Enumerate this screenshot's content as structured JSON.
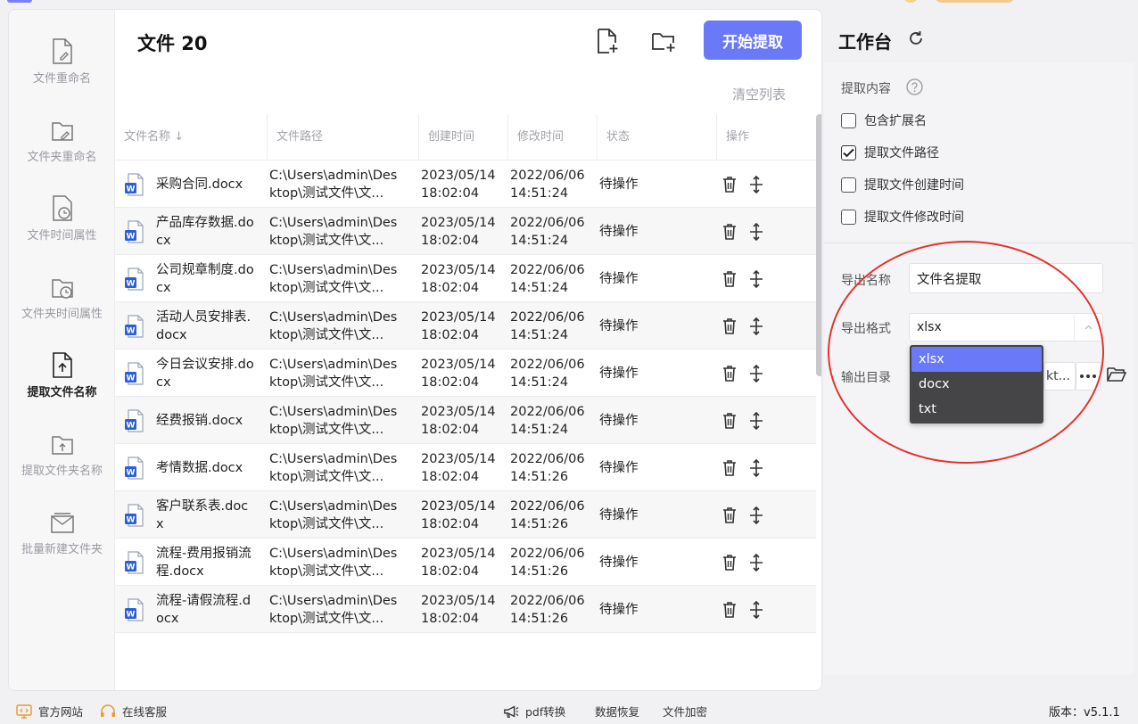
{
  "sidebar": {
    "items": [
      {
        "label": "文件重命名",
        "icon": "file-edit-icon"
      },
      {
        "label": "文件夹重命名",
        "icon": "folder-edit-icon"
      },
      {
        "label": "文件时间属性",
        "icon": "file-clock-icon"
      },
      {
        "label": "文件夹时间属性",
        "icon": "folder-clock-icon"
      },
      {
        "label": "提取文件名称",
        "icon": "file-extract-icon",
        "active": true
      },
      {
        "label": "提取文件夹名称",
        "icon": "folder-extract-icon"
      },
      {
        "label": "批量新建文件夹",
        "icon": "folder-batch-icon"
      }
    ]
  },
  "header": {
    "title": "文件 20",
    "start_label": "开始提取",
    "clear_label": "清空列表",
    "add_file_icon": "add-file-icon",
    "add_folder_icon": "add-folder-icon"
  },
  "table": {
    "columns": [
      "文件名称",
      "文件路径",
      "创建时间",
      "修改时间",
      "状态",
      "操作"
    ],
    "rows": [
      {
        "name": "采购合同.docx",
        "path": "C:\\Users\\admin\\Desktop\\测试文件\\文...",
        "ctime1": "2023/05/14",
        "ctime2": "18:02:04",
        "mtime1": "2022/06/06",
        "mtime2": "14:51:24",
        "status": "待操作"
      },
      {
        "name": "产品库存数据.docx",
        "path": "C:\\Users\\admin\\Desktop\\测试文件\\文...",
        "ctime1": "2023/05/14",
        "ctime2": "18:02:04",
        "mtime1": "2022/06/06",
        "mtime2": "14:51:24",
        "status": "待操作"
      },
      {
        "name": "公司规章制度.docx",
        "path": "C:\\Users\\admin\\Desktop\\测试文件\\文...",
        "ctime1": "2023/05/14",
        "ctime2": "18:02:04",
        "mtime1": "2022/06/06",
        "mtime2": "14:51:24",
        "status": "待操作"
      },
      {
        "name": "活动人员安排表.docx",
        "path": "C:\\Users\\admin\\Desktop\\测试文件\\文...",
        "ctime1": "2023/05/14",
        "ctime2": "18:02:04",
        "mtime1": "2022/06/06",
        "mtime2": "14:51:24",
        "status": "待操作"
      },
      {
        "name": "今日会议安排.docx",
        "path": "C:\\Users\\admin\\Desktop\\测试文件\\文...",
        "ctime1": "2023/05/14",
        "ctime2": "18:02:04",
        "mtime1": "2022/06/06",
        "mtime2": "14:51:24",
        "status": "待操作"
      },
      {
        "name": "经费报销.docx",
        "path": "C:\\Users\\admin\\Desktop\\测试文件\\文...",
        "ctime1": "2023/05/14",
        "ctime2": "18:02:04",
        "mtime1": "2022/06/06",
        "mtime2": "14:51:24",
        "status": "待操作"
      },
      {
        "name": "考情数据.docx",
        "path": "C:\\Users\\admin\\Desktop\\测试文件\\文...",
        "ctime1": "2023/05/14",
        "ctime2": "18:02:04",
        "mtime1": "2022/06/06",
        "mtime2": "14:51:26",
        "status": "待操作"
      },
      {
        "name": "客户联系表.docx",
        "path": "C:\\Users\\admin\\Desktop\\测试文件\\文...",
        "ctime1": "2023/05/14",
        "ctime2": "18:02:04",
        "mtime1": "2022/06/06",
        "mtime2": "14:51:26",
        "status": "待操作"
      },
      {
        "name": "流程-费用报销流程.docx",
        "path": "C:\\Users\\admin\\Desktop\\测试文件\\文...",
        "ctime1": "2023/05/14",
        "ctime2": "18:02:04",
        "mtime1": "2022/06/06",
        "mtime2": "14:51:26",
        "status": "待操作"
      },
      {
        "name": "流程-请假流程.docx",
        "path": "C:\\Users\\admin\\Desktop\\测试文件\\文...",
        "ctime1": "2023/05/14",
        "ctime2": "18:02:04",
        "mtime1": "2022/06/06",
        "mtime2": "14:51:26",
        "status": "待操作"
      }
    ]
  },
  "workbench": {
    "title": "工作台",
    "extract_label": "提取内容",
    "options": [
      {
        "label": "包含扩展名",
        "checked": false
      },
      {
        "label": "提取文件路径",
        "checked": true
      },
      {
        "label": "提取文件创建时间",
        "checked": false
      },
      {
        "label": "提取文件修改时间",
        "checked": false
      }
    ],
    "export_name_label": "导出名称",
    "export_name_value": "文件名提取",
    "export_format_label": "导出格式",
    "export_format_value": "xlsx",
    "output_dir_label": "输出目录",
    "output_dir_value": "kt...",
    "format_options": [
      "xlsx",
      "docx",
      "txt"
    ]
  },
  "footer": {
    "website": "官方网站",
    "support": "在线客服",
    "pdf": "pdf转换",
    "recovery": "数据恢复",
    "encrypt": "文件加密",
    "version": "版本：v5.1.1"
  },
  "colors": {
    "accent": "#6a79f7",
    "annotation": "#e4332b",
    "word_blue": "#2b5fd9"
  }
}
